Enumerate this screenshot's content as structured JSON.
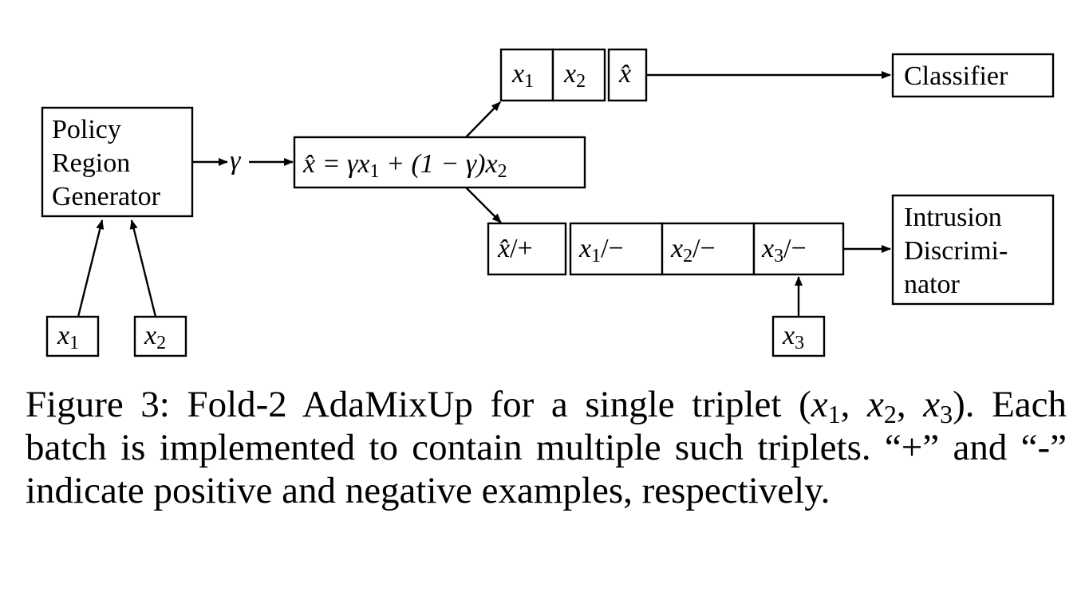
{
  "diagram": {
    "policy_generator": {
      "lines": [
        "Policy",
        "Region",
        "Generator"
      ]
    },
    "gamma_label": "γ",
    "mix_formula": {
      "parts": [
        "x̂ = γx",
        "1",
        " + (1 − γ)x",
        "2"
      ]
    },
    "inputs": [
      {
        "var": "x",
        "sub": "1"
      },
      {
        "var": "x",
        "sub": "2"
      },
      {
        "var": "x",
        "sub": "3"
      }
    ],
    "classifier_batch": [
      {
        "var": "x",
        "sub": "1",
        "suffix": ""
      },
      {
        "var": "x",
        "sub": "2",
        "suffix": ""
      },
      {
        "var": "x̂",
        "sub": "",
        "suffix": ""
      }
    ],
    "discriminator_batch": [
      {
        "var": "x̂",
        "sub": "",
        "suffix": "/+"
      },
      {
        "var": "x",
        "sub": "1",
        "suffix": "/−"
      },
      {
        "var": "x",
        "sub": "2",
        "suffix": "/−"
      },
      {
        "var": "x",
        "sub": "3",
        "suffix": "/−"
      }
    ],
    "classifier": {
      "label": "Classifier"
    },
    "discriminator": {
      "lines": [
        "Intrusion",
        "Discrimi-",
        "nator"
      ]
    }
  },
  "caption": {
    "prefix": "Figure 3:  Fold-2 AdaMixUp for a single triplet (",
    "triplet": [
      {
        "var": "x",
        "sub": "1"
      },
      {
        "var": "x",
        "sub": "2"
      },
      {
        "var": "x",
        "sub": "3"
      }
    ],
    "suffix": "). Each batch is implemented to contain multiple such triplets. “+” and “-” indicate positive and negative examples, respectively."
  }
}
